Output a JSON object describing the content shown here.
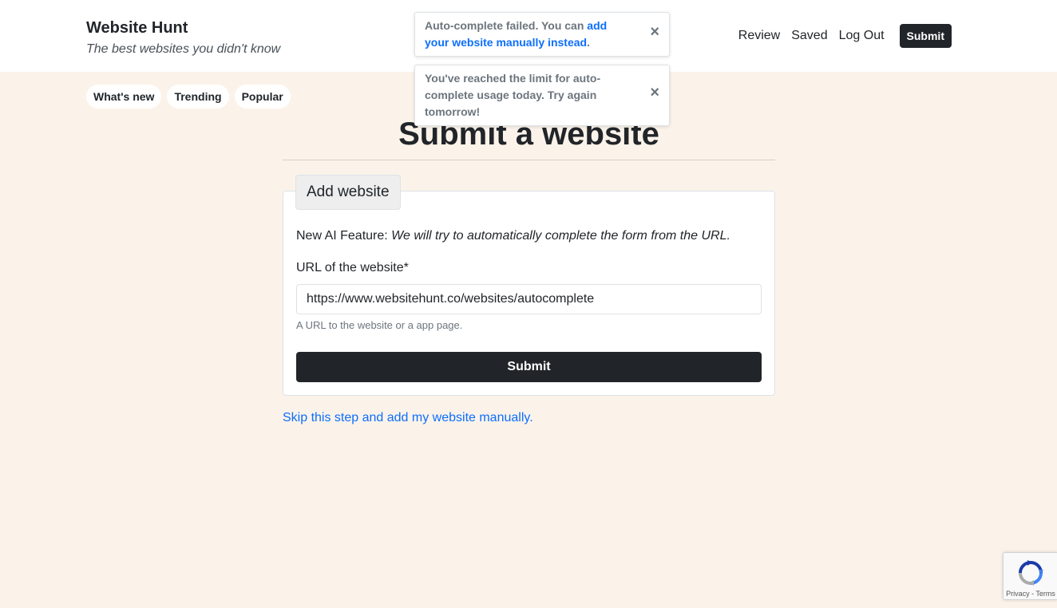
{
  "header": {
    "brand_title": "Website Hunt",
    "tagline": "The best websites you didn't know",
    "nav": [
      {
        "label": "Review"
      },
      {
        "label": "Saved"
      },
      {
        "label": "Log Out"
      }
    ],
    "submit_label": "Submit"
  },
  "filters": [
    {
      "label": "What's new"
    },
    {
      "label": "Trending"
    },
    {
      "label": "Popular"
    }
  ],
  "toasts": [
    {
      "text_before": "Auto-complete failed. You can ",
      "link_text": "add your website manually instead",
      "text_after": ".",
      "close_icon": "×"
    },
    {
      "text": "You've reached the limit for auto-complete usage today. Try again tomorrow!",
      "close_icon": "×"
    }
  ],
  "main": {
    "title": "Submit a website",
    "card_legend": "Add website",
    "feature_label": "New AI Feature: ",
    "feature_text": "We will try to automatically complete the form from the URL.",
    "url_field": {
      "label": "URL of the website*",
      "value": "https://www.websitehunt.co/websites/autocomplete",
      "help": "A URL to the website or a app page."
    },
    "submit_label": "Submit",
    "skip_link": "Skip this step and add my website manually."
  },
  "recaptcha": {
    "icon": "recaptcha-icon",
    "terms": "Privacy - Terms"
  },
  "colors": {
    "page_bg": "#fbf3ea",
    "dark_button": "#212529",
    "link": "#0d6efd"
  }
}
